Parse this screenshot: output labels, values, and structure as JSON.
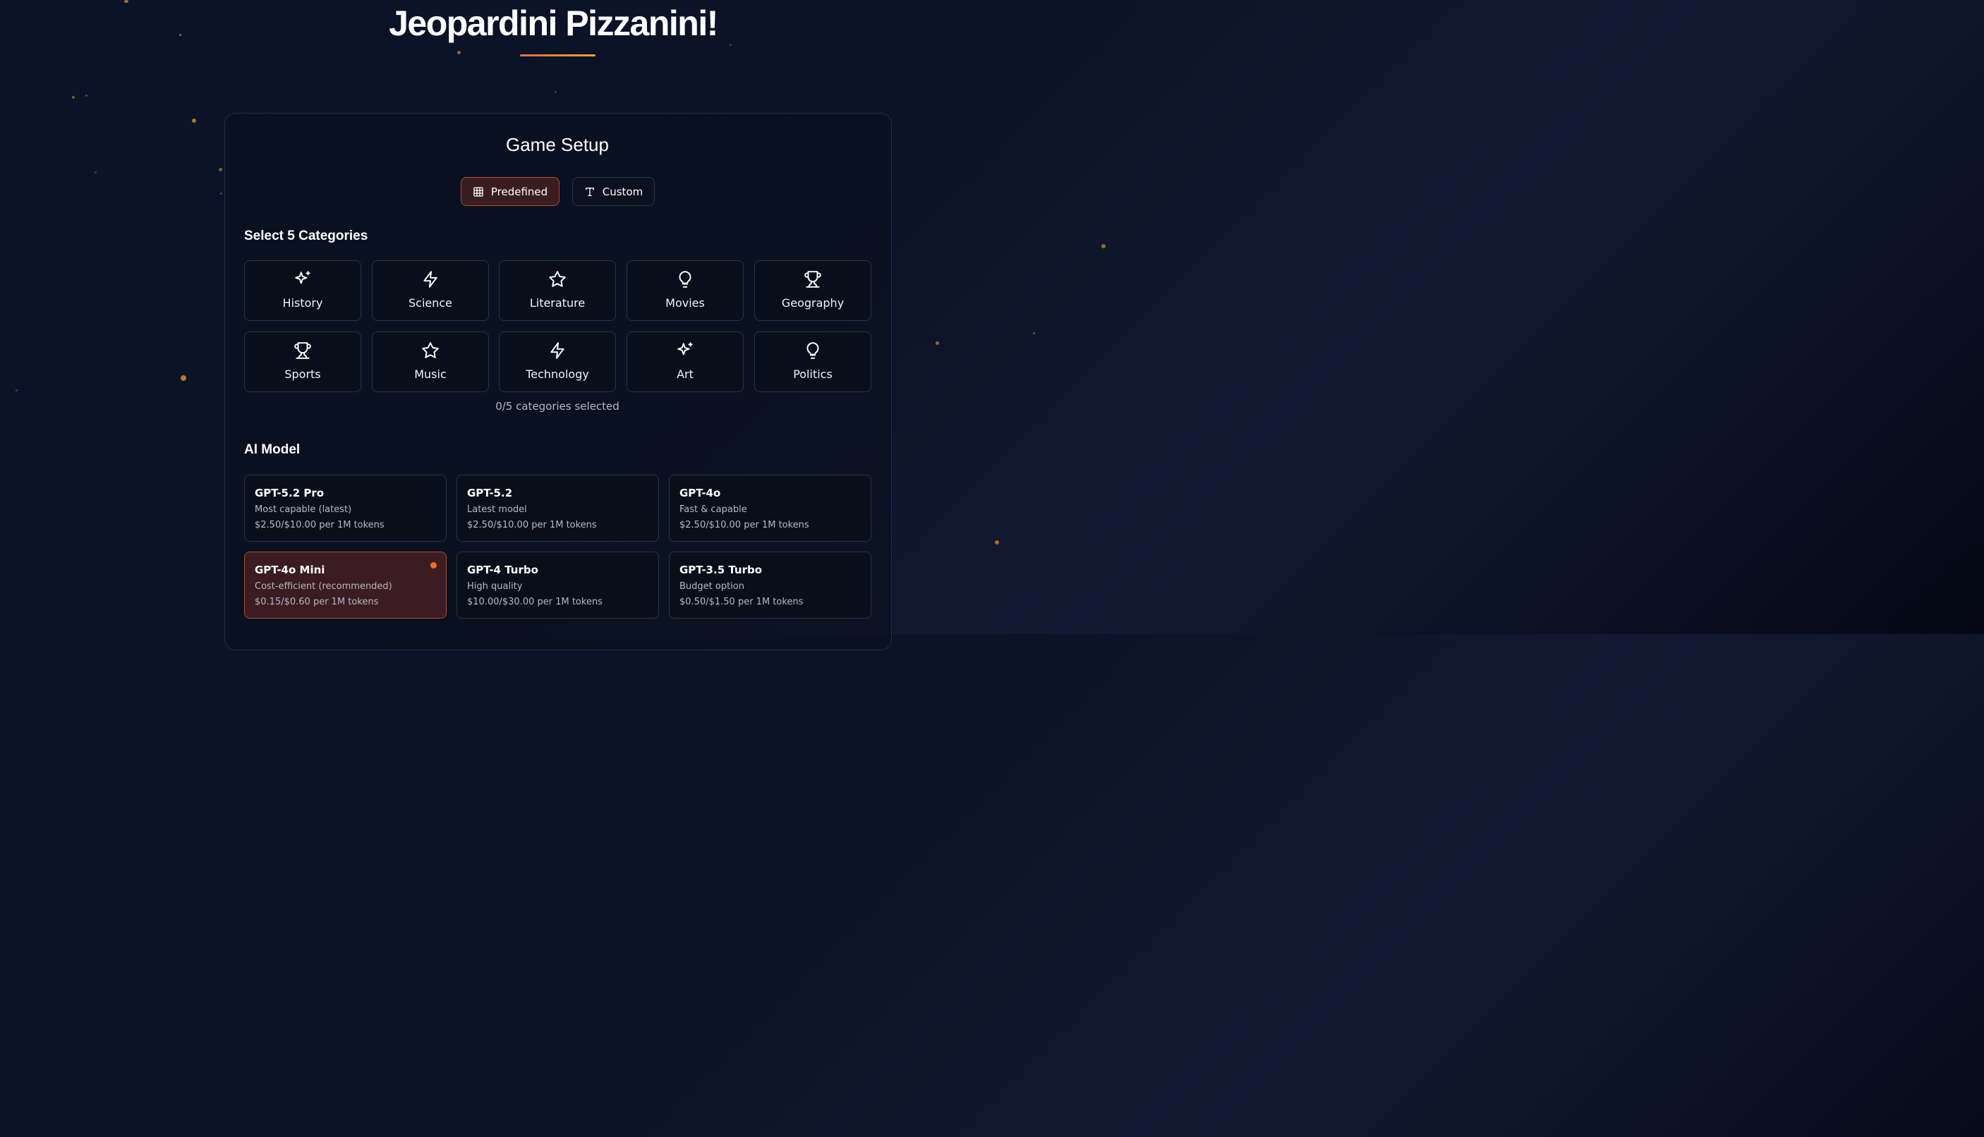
{
  "app": {
    "title": "Jeopardini Pizzanini!"
  },
  "setup": {
    "title": "Game Setup",
    "tabs": [
      {
        "label": "Predefined",
        "icon": "grid-icon",
        "active": true
      },
      {
        "label": "Custom",
        "icon": "text-icon",
        "active": false
      }
    ],
    "categories_label": "Select 5 Categories",
    "categories": [
      {
        "label": "History",
        "icon": "sparkles-icon"
      },
      {
        "label": "Science",
        "icon": "zap-icon"
      },
      {
        "label": "Literature",
        "icon": "star-icon"
      },
      {
        "label": "Movies",
        "icon": "lightbulb-icon"
      },
      {
        "label": "Geography",
        "icon": "trophy-icon"
      },
      {
        "label": "Sports",
        "icon": "trophy-icon"
      },
      {
        "label": "Music",
        "icon": "star-icon"
      },
      {
        "label": "Technology",
        "icon": "zap-icon"
      },
      {
        "label": "Art",
        "icon": "sparkles-icon"
      },
      {
        "label": "Politics",
        "icon": "lightbulb-icon"
      }
    ],
    "selected_count_text": "0/5 categories selected",
    "model_label": "AI Model",
    "models": [
      {
        "name": "GPT-5.2 Pro",
        "desc": "Most capable (latest)",
        "price": "$2.50/$10.00 per 1M tokens",
        "selected": false
      },
      {
        "name": "GPT-5.2",
        "desc": "Latest model",
        "price": "$2.50/$10.00 per 1M tokens",
        "selected": false
      },
      {
        "name": "GPT-4o",
        "desc": "Fast & capable",
        "price": "$2.50/$10.00 per 1M tokens",
        "selected": false
      },
      {
        "name": "GPT-4o Mini",
        "desc": "Cost-efficient (recommended)",
        "price": "$0.15/$0.60 per 1M tokens",
        "selected": true
      },
      {
        "name": "GPT-4 Turbo",
        "desc": "High quality",
        "price": "$10.00/$30.00 per 1M tokens",
        "selected": false
      },
      {
        "name": "GPT-3.5 Turbo",
        "desc": "Budget option",
        "price": "$0.50/$1.50 per 1M tokens",
        "selected": false
      }
    ]
  },
  "colors": {
    "accent": "#f26b1d",
    "selected_bg": "#3a1c22",
    "selected_border": "#b04a2a",
    "card_border": "#2a3244",
    "title_underline": [
      "#f2674a",
      "#f5a623"
    ]
  }
}
